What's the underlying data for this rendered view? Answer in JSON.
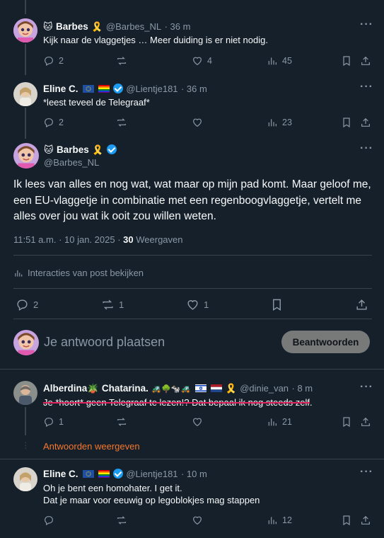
{
  "tweets": [
    {
      "name": "Barbes",
      "handle": "@Barbes_NL",
      "time": "· 36 m",
      "text": "Kijk naar de vlaggetjes … Meer duiding is er niet nodig.",
      "replies": "2",
      "reposts": "",
      "likes": "4",
      "views": "45"
    },
    {
      "name": "Eline C.",
      "handle": "@Lientje181",
      "time": "· 36 m",
      "text": "*leest teveel de Telegraaf*",
      "replies": "2",
      "reposts": "",
      "likes": "",
      "views": "23"
    }
  ],
  "main": {
    "name": "Barbes",
    "handle": "@Barbes_NL",
    "text": "Ik lees van alles en nog wat, wat maar op mijn pad komt. Maar geloof me, een EU-vlaggetje in combinatie met een regenboogvlaggetje, vertelt me alles over jou wat ik ooit zou willen weten.",
    "time": "11:51 a.m. · 10 jan. 2025 ·",
    "views_count": "30",
    "views_label": "Weergaven",
    "interactions_label": "Interacties van post bekijken",
    "replies": "2",
    "reposts": "1",
    "likes": "1"
  },
  "compose": {
    "placeholder": "Je antwoord plaatsen",
    "button": "Beantwoorden"
  },
  "replies": [
    {
      "name": "Alberdina",
      "name2": "Chatarina.",
      "handle": "@dinie_van",
      "time": "· 8 m",
      "text_pre": "Je *hoort* geen Telegraaf te lezen!? Dat bepaal ik nog steeds zelf",
      "text_post": ".",
      "replies": "1",
      "reposts": "",
      "likes": "",
      "views": "21",
      "show_replies": "Antwoorden weergeven"
    },
    {
      "name": "Eline C.",
      "handle": "@Lientje181",
      "time": "· 10 m",
      "line1": "Oh je bent een homohater. I get it.",
      "line2": "Dat je maar voor eeuwig op legoblokjes mag stappen",
      "replies": "",
      "reposts": "",
      "likes": "",
      "views": "12"
    }
  ],
  "colors": {
    "background": "#15202b",
    "accent": "#1d9bf0",
    "muted": "#8b98a5",
    "orange_link": "#f6772b"
  }
}
